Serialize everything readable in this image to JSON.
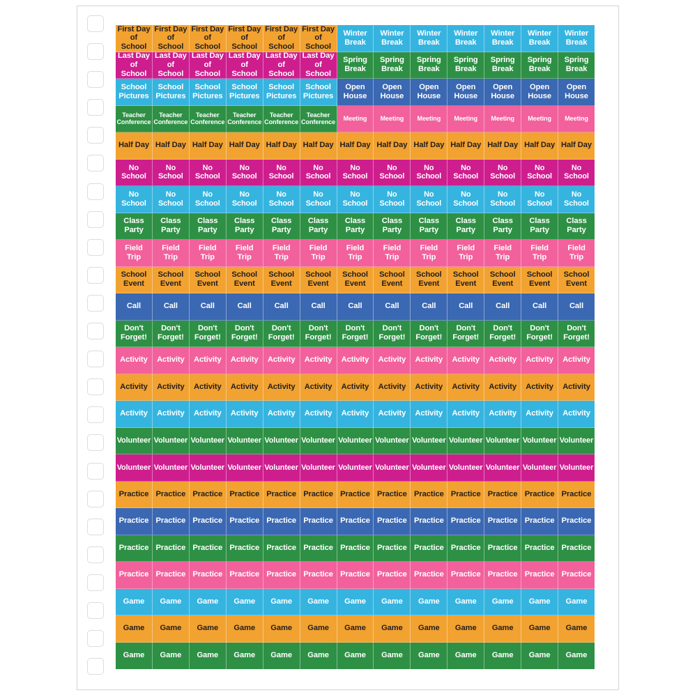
{
  "page": {
    "type": "sticker-sheet",
    "punch_hole_count": 24,
    "grid_columns": 13,
    "grid_rows": 24
  },
  "palette": {
    "orange": "#F2A230",
    "magenta": "#CE1E8E",
    "cyan": "#36B4E0",
    "green": "#2E9045",
    "pink": "#F2619B",
    "blue": "#3B68B2",
    "hot_pink": "#EF5E9C",
    "white": "#FFFFFF",
    "dark_text": "#231F20"
  },
  "rows": [
    {
      "index": 0,
      "name": "first-day-winter-break",
      "size": "lg",
      "segments": [
        {
          "label": "First Day\nof School",
          "count": 6,
          "bg": "#F2A230",
          "fg": "#231F20"
        },
        {
          "label": "Winter\nBreak",
          "count": 7,
          "bg": "#36B4E0",
          "fg": "#FFFFFF"
        }
      ]
    },
    {
      "index": 1,
      "name": "last-day-spring-break",
      "size": "lg",
      "segments": [
        {
          "label": "Last Day\nof School",
          "count": 6,
          "bg": "#CE1E8E",
          "fg": "#FFFFFF"
        },
        {
          "label": "Spring\nBreak",
          "count": 7,
          "bg": "#2E9045",
          "fg": "#FFFFFF"
        }
      ]
    },
    {
      "index": 2,
      "name": "school-pictures-open-house",
      "size": "lg",
      "segments": [
        {
          "label": "School\nPictures",
          "count": 6,
          "bg": "#36B4E0",
          "fg": "#FFFFFF"
        },
        {
          "label": "Open\nHouse",
          "count": 7,
          "bg": "#3B68B2",
          "fg": "#FFFFFF"
        }
      ]
    },
    {
      "index": 3,
      "name": "teacher-conference-meeting",
      "size": "sm",
      "segments": [
        {
          "label": "Teacher\nConference",
          "count": 6,
          "bg": "#2E9045",
          "fg": "#FFFFFF"
        },
        {
          "label": "Meeting",
          "count": 7,
          "bg": "#F2619B",
          "fg": "#FFFFFF"
        }
      ]
    },
    {
      "index": 4,
      "name": "half-day",
      "size": "lg",
      "segments": [
        {
          "label": "Half Day",
          "count": 13,
          "bg": "#F2A230",
          "fg": "#231F20"
        }
      ]
    },
    {
      "index": 5,
      "name": "no-school-magenta",
      "size": "md",
      "segments": [
        {
          "label": "No School",
          "count": 13,
          "bg": "#CE1E8E",
          "fg": "#FFFFFF"
        }
      ]
    },
    {
      "index": 6,
      "name": "no-school-cyan",
      "size": "md",
      "segments": [
        {
          "label": "No School",
          "count": 13,
          "bg": "#36B4E0",
          "fg": "#FFFFFF"
        }
      ]
    },
    {
      "index": 7,
      "name": "class-party",
      "size": "lg",
      "segments": [
        {
          "label": "Class\nParty",
          "count": 13,
          "bg": "#2E9045",
          "fg": "#FFFFFF"
        }
      ]
    },
    {
      "index": 8,
      "name": "field-trip",
      "size": "lg",
      "segments": [
        {
          "label": "Field\nTrip",
          "count": 13,
          "bg": "#F2619B",
          "fg": "#FFFFFF"
        }
      ]
    },
    {
      "index": 9,
      "name": "school-event",
      "size": "lg",
      "segments": [
        {
          "label": "School\nEvent",
          "count": 13,
          "bg": "#F2A230",
          "fg": "#231F20"
        }
      ]
    },
    {
      "index": 10,
      "name": "call",
      "size": "lg",
      "segments": [
        {
          "label": "Call",
          "count": 13,
          "bg": "#3B68B2",
          "fg": "#FFFFFF"
        }
      ]
    },
    {
      "index": 11,
      "name": "dont-forget",
      "size": "lg",
      "segments": [
        {
          "label": "Don't\nForget!",
          "count": 13,
          "bg": "#2E9045",
          "fg": "#FFFFFF"
        }
      ]
    },
    {
      "index": 12,
      "name": "activity-pink",
      "size": "lg",
      "segments": [
        {
          "label": "Activity",
          "count": 13,
          "bg": "#F2619B",
          "fg": "#FFFFFF"
        }
      ]
    },
    {
      "index": 13,
      "name": "activity-orange",
      "size": "lg",
      "segments": [
        {
          "label": "Activity",
          "count": 13,
          "bg": "#F2A230",
          "fg": "#231F20"
        }
      ]
    },
    {
      "index": 14,
      "name": "activity-cyan",
      "size": "lg",
      "segments": [
        {
          "label": "Activity",
          "count": 13,
          "bg": "#36B4E0",
          "fg": "#FFFFFF"
        }
      ]
    },
    {
      "index": 15,
      "name": "volunteer-green",
      "size": "md",
      "segments": [
        {
          "label": "Volunteer",
          "count": 13,
          "bg": "#2E9045",
          "fg": "#FFFFFF"
        }
      ]
    },
    {
      "index": 16,
      "name": "volunteer-magenta",
      "size": "md",
      "segments": [
        {
          "label": "Volunteer",
          "count": 13,
          "bg": "#CE1E8E",
          "fg": "#FFFFFF"
        }
      ]
    },
    {
      "index": 17,
      "name": "practice-orange",
      "size": "lg",
      "segments": [
        {
          "label": "Practice",
          "count": 13,
          "bg": "#F2A230",
          "fg": "#231F20"
        }
      ]
    },
    {
      "index": 18,
      "name": "practice-blue",
      "size": "lg",
      "segments": [
        {
          "label": "Practice",
          "count": 13,
          "bg": "#3B68B2",
          "fg": "#FFFFFF"
        }
      ]
    },
    {
      "index": 19,
      "name": "practice-green",
      "size": "lg",
      "segments": [
        {
          "label": "Practice",
          "count": 13,
          "bg": "#2E9045",
          "fg": "#FFFFFF"
        }
      ]
    },
    {
      "index": 20,
      "name": "practice-pink",
      "size": "lg",
      "segments": [
        {
          "label": "Practice",
          "count": 13,
          "bg": "#F2619B",
          "fg": "#FFFFFF"
        }
      ]
    },
    {
      "index": 21,
      "name": "game-cyan",
      "size": "lg",
      "segments": [
        {
          "label": "Game",
          "count": 13,
          "bg": "#36B4E0",
          "fg": "#FFFFFF"
        }
      ]
    },
    {
      "index": 22,
      "name": "game-orange",
      "size": "lg",
      "segments": [
        {
          "label": "Game",
          "count": 13,
          "bg": "#F2A230",
          "fg": "#231F20"
        }
      ]
    },
    {
      "index": 23,
      "name": "game-green",
      "size": "lg",
      "segments": [
        {
          "label": "Game",
          "count": 13,
          "bg": "#2E9045",
          "fg": "#FFFFFF"
        }
      ]
    }
  ]
}
